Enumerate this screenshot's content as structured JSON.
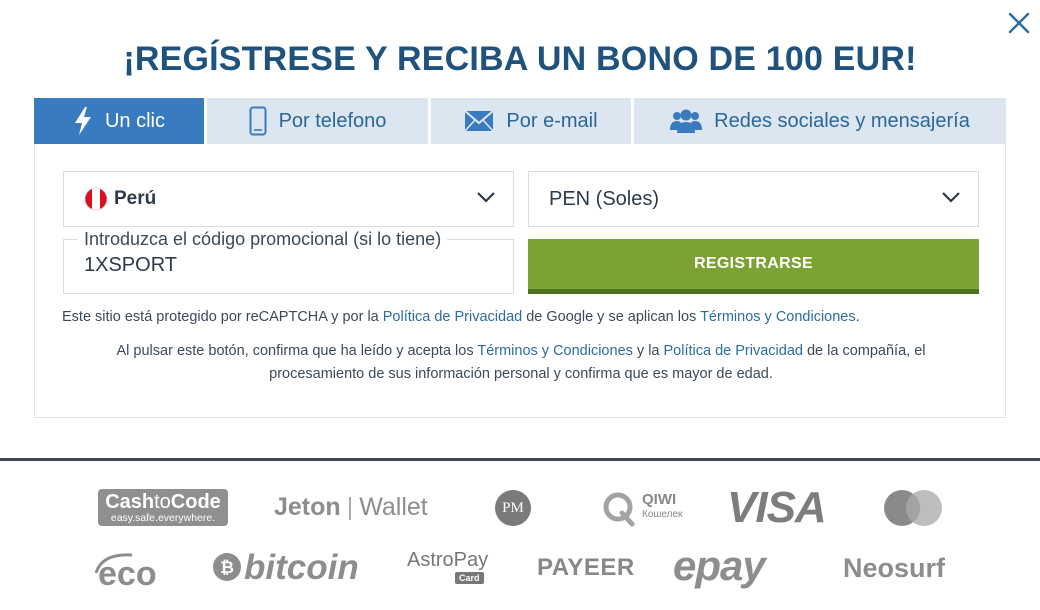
{
  "header": {
    "title": "¡REGÍSTRESE Y RECIBA UN BONO DE 100 EUR!",
    "close_icon": "close-icon"
  },
  "tabs": [
    {
      "label": "Un clic",
      "icon": "lightning-icon",
      "active": true
    },
    {
      "label": "Por telefono",
      "icon": "phone-icon",
      "active": false
    },
    {
      "label": "Por e-mail",
      "icon": "mail-icon",
      "active": false
    },
    {
      "label": "Redes sociales y mensajería",
      "icon": "people-icon",
      "active": false
    }
  ],
  "form": {
    "country": {
      "value": "Perú",
      "icon": "peru-flag-icon"
    },
    "currency": {
      "value": "PEN (Soles)"
    },
    "promo": {
      "label": "Introduzca el código promocional (si lo tiene)",
      "value": "1XSPORT"
    },
    "submit_label": "REGISTRARSE"
  },
  "recaptcha_note": {
    "pre": "Este sitio está protegido por reCAPTCHA y por la ",
    "privacy_link": "Política de Privacidad",
    "mid": " de Google y se aplican los ",
    "terms_link": "Términos y Condiciones",
    "post": "."
  },
  "consent_note": {
    "pre": "Al pulsar este botón, confirma que ha leído y acepta los ",
    "terms_link": "Términos y Condiciones",
    "mid": " y la ",
    "privacy_link": "Política de Privacidad",
    "post": " de la compañía, el procesamiento de sus información personal y confirma que es mayor de edad."
  },
  "payment_logos": {
    "cashtocode": {
      "main_a": "Cash",
      "main_b": "to",
      "main_c": "Code",
      "sub": "easy.safe.everywhere."
    },
    "jeton": {
      "left": "Jeton",
      "right": "Wallet"
    },
    "perfectmoney": "PM",
    "qiwi": {
      "name": "QIWI",
      "sub": "Кошелек"
    },
    "visa": "VISA",
    "ecopayz": "eco",
    "bitcoin": "bitcoin",
    "astropay": {
      "name": "AstroPay",
      "sub": "Card"
    },
    "payeer": "PAYEER",
    "epay": "epay",
    "neosurf": "Neosurf"
  },
  "colors": {
    "brand_title": "#20527e",
    "tab_active": "#3a7bc0",
    "tab_inactive": "#dbe6f0",
    "submit": "#7aa333",
    "link": "#2b6d9f"
  }
}
